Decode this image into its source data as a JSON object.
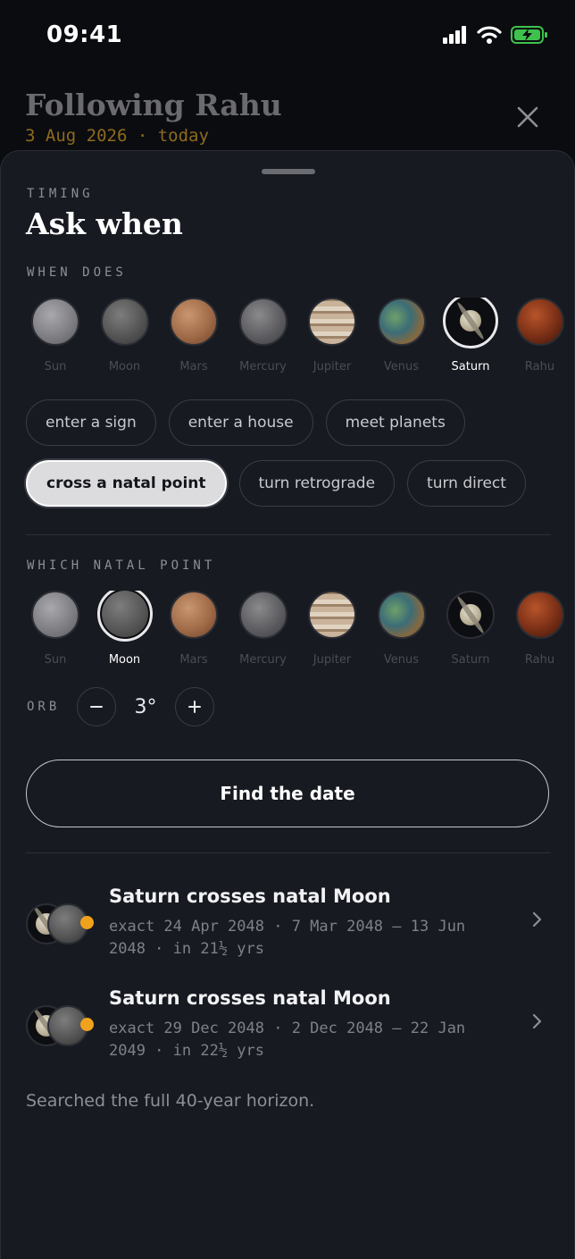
{
  "status": {
    "time": "09:41"
  },
  "background": {
    "title": "Following Rahu",
    "subtitle": "3 Aug 2026 · today"
  },
  "sheet": {
    "eyebrow": "TIMING",
    "title": "Ask when",
    "when_label": "WHEN DOES",
    "natal_label": "WHICH NATAL POINT",
    "orb_label": "ORB",
    "orb_value": "3°",
    "find_label": "Find the date",
    "footer": "Searched the full 40-year horizon."
  },
  "planets": [
    {
      "name": "Sun",
      "icon": "sun"
    },
    {
      "name": "Moon",
      "icon": "moon"
    },
    {
      "name": "Mars",
      "icon": "mars"
    },
    {
      "name": "Mercury",
      "icon": "mercury"
    },
    {
      "name": "Jupiter",
      "icon": "jupiter"
    },
    {
      "name": "Venus",
      "icon": "venus"
    },
    {
      "name": "Saturn",
      "icon": "saturn"
    },
    {
      "name": "Rahu",
      "icon": "rahu"
    }
  ],
  "selected_transit": "Saturn",
  "selected_natal": "Moon",
  "events": [
    {
      "label": "enter a sign"
    },
    {
      "label": "enter a house"
    },
    {
      "label": "meet planets"
    },
    {
      "label": "cross a natal point",
      "active": true
    },
    {
      "label": "turn retrograde"
    },
    {
      "label": "turn direct"
    }
  ],
  "results": [
    {
      "title": "Saturn crosses natal Moon",
      "detail": "exact 24 Apr 2048 · 7 Mar 2048 – 13 Jun 2048 · in 21½ yrs"
    },
    {
      "title": "Saturn crosses natal Moon",
      "detail": "exact 29 Dec 2048 · 2 Dec 2048 – 22 Jan 2049 · in 22½ yrs"
    }
  ],
  "colors": {
    "accent_dot": "#f0a21c",
    "sheet_bg": "#171a21"
  }
}
